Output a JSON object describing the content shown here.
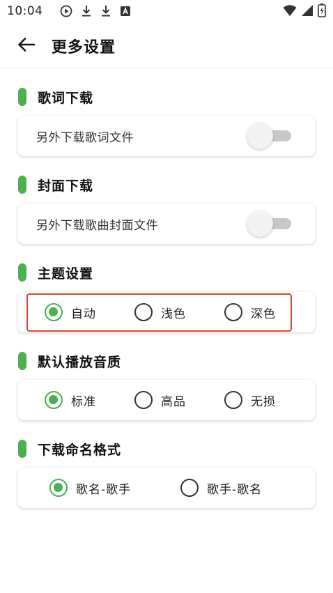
{
  "status_bar": {
    "time": "10:04",
    "icons_left": [
      "play-circle-icon",
      "download-icon",
      "download-icon",
      "a-box-icon"
    ],
    "icons_right": [
      "wifi-icon",
      "signal-icon",
      "battery-icon"
    ]
  },
  "header": {
    "title": "更多设置",
    "back_icon": "arrow-left-icon"
  },
  "accent_color": "#4caf50",
  "highlight_color": "#d44a3a",
  "sections": [
    {
      "title": "歌词下载",
      "type": "switch",
      "label": "另外下载歌词文件",
      "on": false
    },
    {
      "title": "封面下载",
      "type": "switch",
      "label": "另外下载歌曲封面文件",
      "on": false
    },
    {
      "title": "主题设置",
      "type": "radio",
      "options": [
        "自动",
        "浅色",
        "深色"
      ],
      "selected": "自动"
    },
    {
      "title": "默认播放音质",
      "type": "radio",
      "options": [
        "标准",
        "高品",
        "无损"
      ],
      "selected": "标准"
    },
    {
      "title": "下载命名格式",
      "type": "radio",
      "options": [
        "歌名-歌手",
        "歌手-歌名"
      ],
      "selected": "歌名-歌手"
    }
  ]
}
